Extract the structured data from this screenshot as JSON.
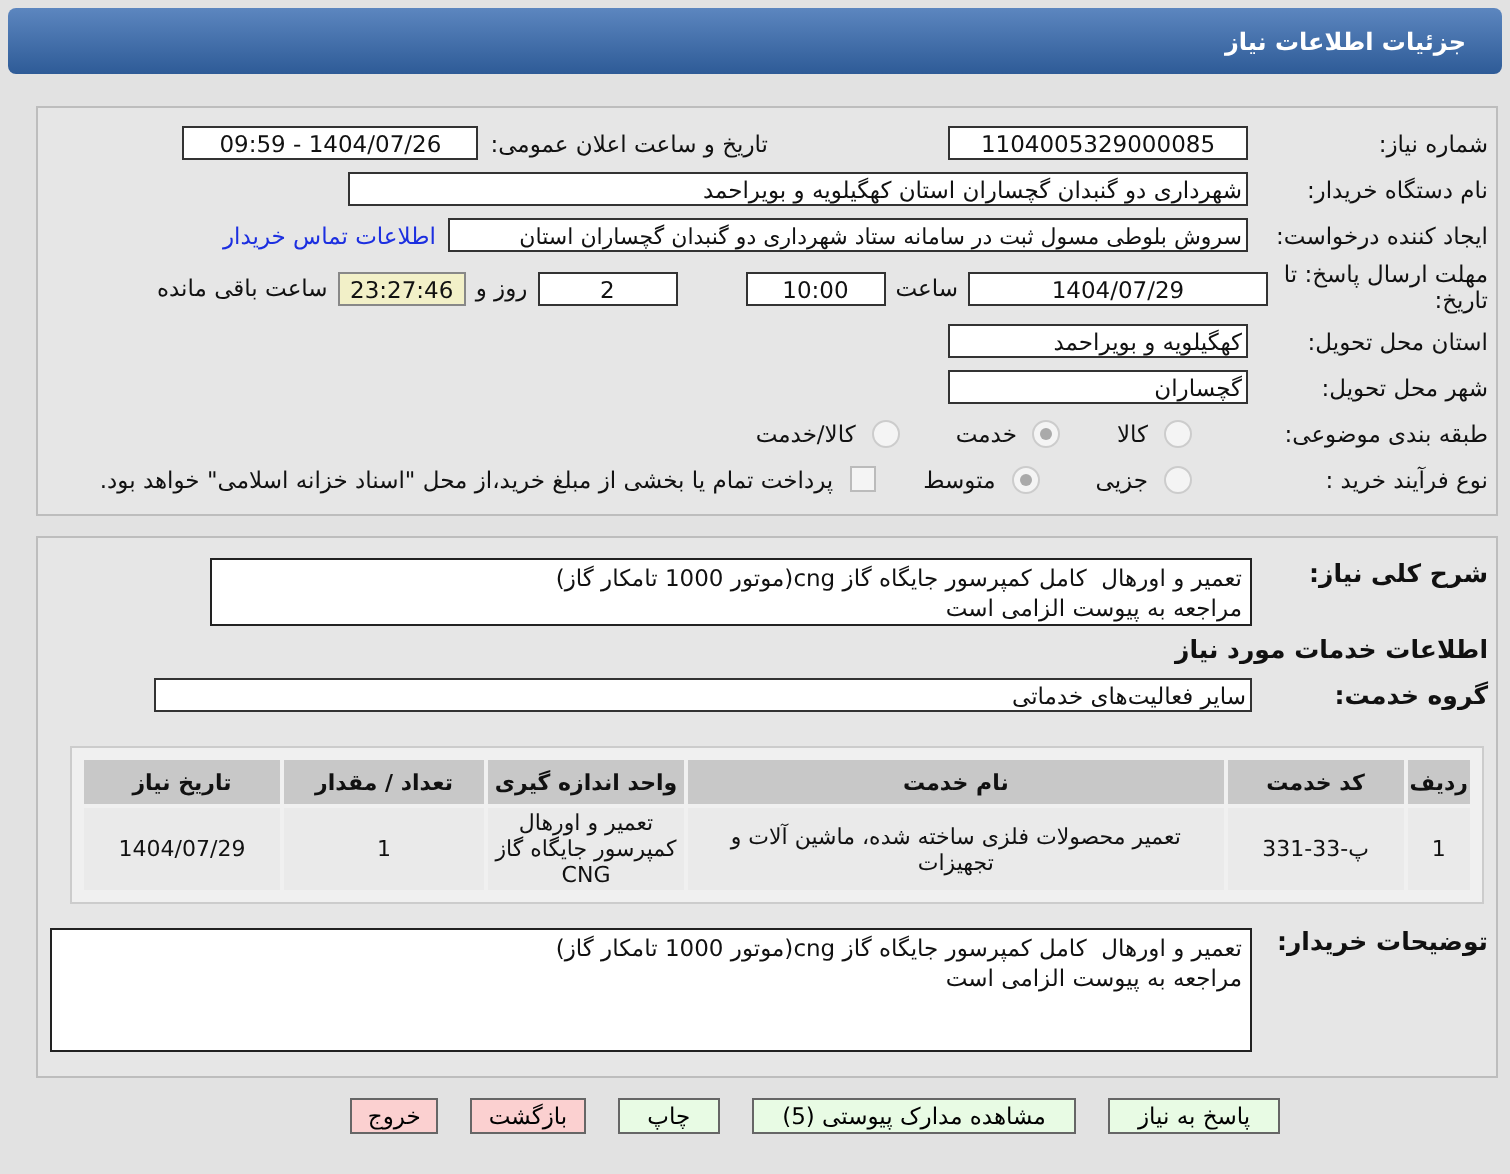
{
  "header": {
    "title": "جزئیات اطلاعات نیاز"
  },
  "need_number": {
    "label": "شماره نیاز:",
    "value": "1104005329000085"
  },
  "announce": {
    "label": "تاریخ و ساعت اعلان عمومی:",
    "value": "1404/07/26 - 09:59"
  },
  "buyer": {
    "label": "نام دستگاه خریدار:",
    "value": "شهرداری دو گنبدان گچساران استان کهگیلویه و بویراحمد"
  },
  "creator": {
    "label": "ایجاد کننده درخواست:",
    "value": "سروش بلوطی مسول ثبت در سامانه ستاد شهرداری دو گنبدان گچساران استان",
    "link": "اطلاعات تماس خریدار"
  },
  "deadline": {
    "label": "مهلت ارسال پاسخ: تا تاریخ:",
    "date": "1404/07/29",
    "time_label": "ساعت",
    "time": "10:00",
    "days": "2",
    "days_label": "روز و",
    "remaining": "23:27:46",
    "remaining_label": "ساعت باقی مانده"
  },
  "province": {
    "label": "استان محل تحویل:",
    "value": "کهگیلویه و بویراحمد"
  },
  "city": {
    "label": "شهر محل تحویل:",
    "value": "گچساران"
  },
  "category": {
    "label": "طبقه بندی موضوعی:",
    "options": [
      {
        "label": "کالا",
        "selected": false
      },
      {
        "label": "خدمت",
        "selected": true
      },
      {
        "label": "کالا/خدمت",
        "selected": false
      }
    ]
  },
  "process": {
    "label": "نوع فرآیند خرید :",
    "options": [
      {
        "label": "جزیی",
        "selected": false
      },
      {
        "label": "متوسط",
        "selected": true
      }
    ],
    "payment": {
      "label": "پرداخت تمام یا بخشی از مبلغ خرید،از محل \"اسناد خزانه اسلامی\" خواهد بود.",
      "checked": false
    }
  },
  "summary": {
    "label": "شرح کلی نیاز:",
    "lines": [
      "تعمیر و اورهال  کامل کمپرسور جایگاه گاز cng(موتور 1000 تامکار گاز)",
      "مراجعه به پیوست الزامی است"
    ]
  },
  "services_heading": "اطلاعات خدمات مورد نیاز",
  "service_group": {
    "label": "گروه خدمت:",
    "value": "سایر فعالیت‌های خدماتی"
  },
  "table": {
    "columns": [
      "ردیف",
      "کد خدمت",
      "نام خدمت",
      "واحد اندازه گیری",
      "تعداد / مقدار",
      "تاریخ نیاز"
    ],
    "rows": [
      [
        "1",
        "پ-33-331",
        "تعمیر محصولات فلزی ساخته شده، ماشین آلات و تجهیزات",
        "تعمیر و اورهال کمپرسور جایگاه گاز CNG",
        "1",
        "1404/07/29"
      ]
    ]
  },
  "buyer_notes": {
    "label": "توضیحات خریدار:",
    "lines": [
      "تعمیر و اورهال  کامل کمپرسور جایگاه گاز cng(موتور 1000 تامکار گاز)",
      "مراجعه به پیوست الزامی است"
    ]
  },
  "buttons": [
    {
      "label": "پاسخ به نیاز",
      "kind": "normal"
    },
    {
      "label": "مشاهده مدارک پیوستی (5)",
      "kind": "normal"
    },
    {
      "label": "چاپ",
      "kind": "normal"
    },
    {
      "label": "بازگشت",
      "kind": "danger"
    },
    {
      "label": "خروج",
      "kind": "danger"
    }
  ]
}
